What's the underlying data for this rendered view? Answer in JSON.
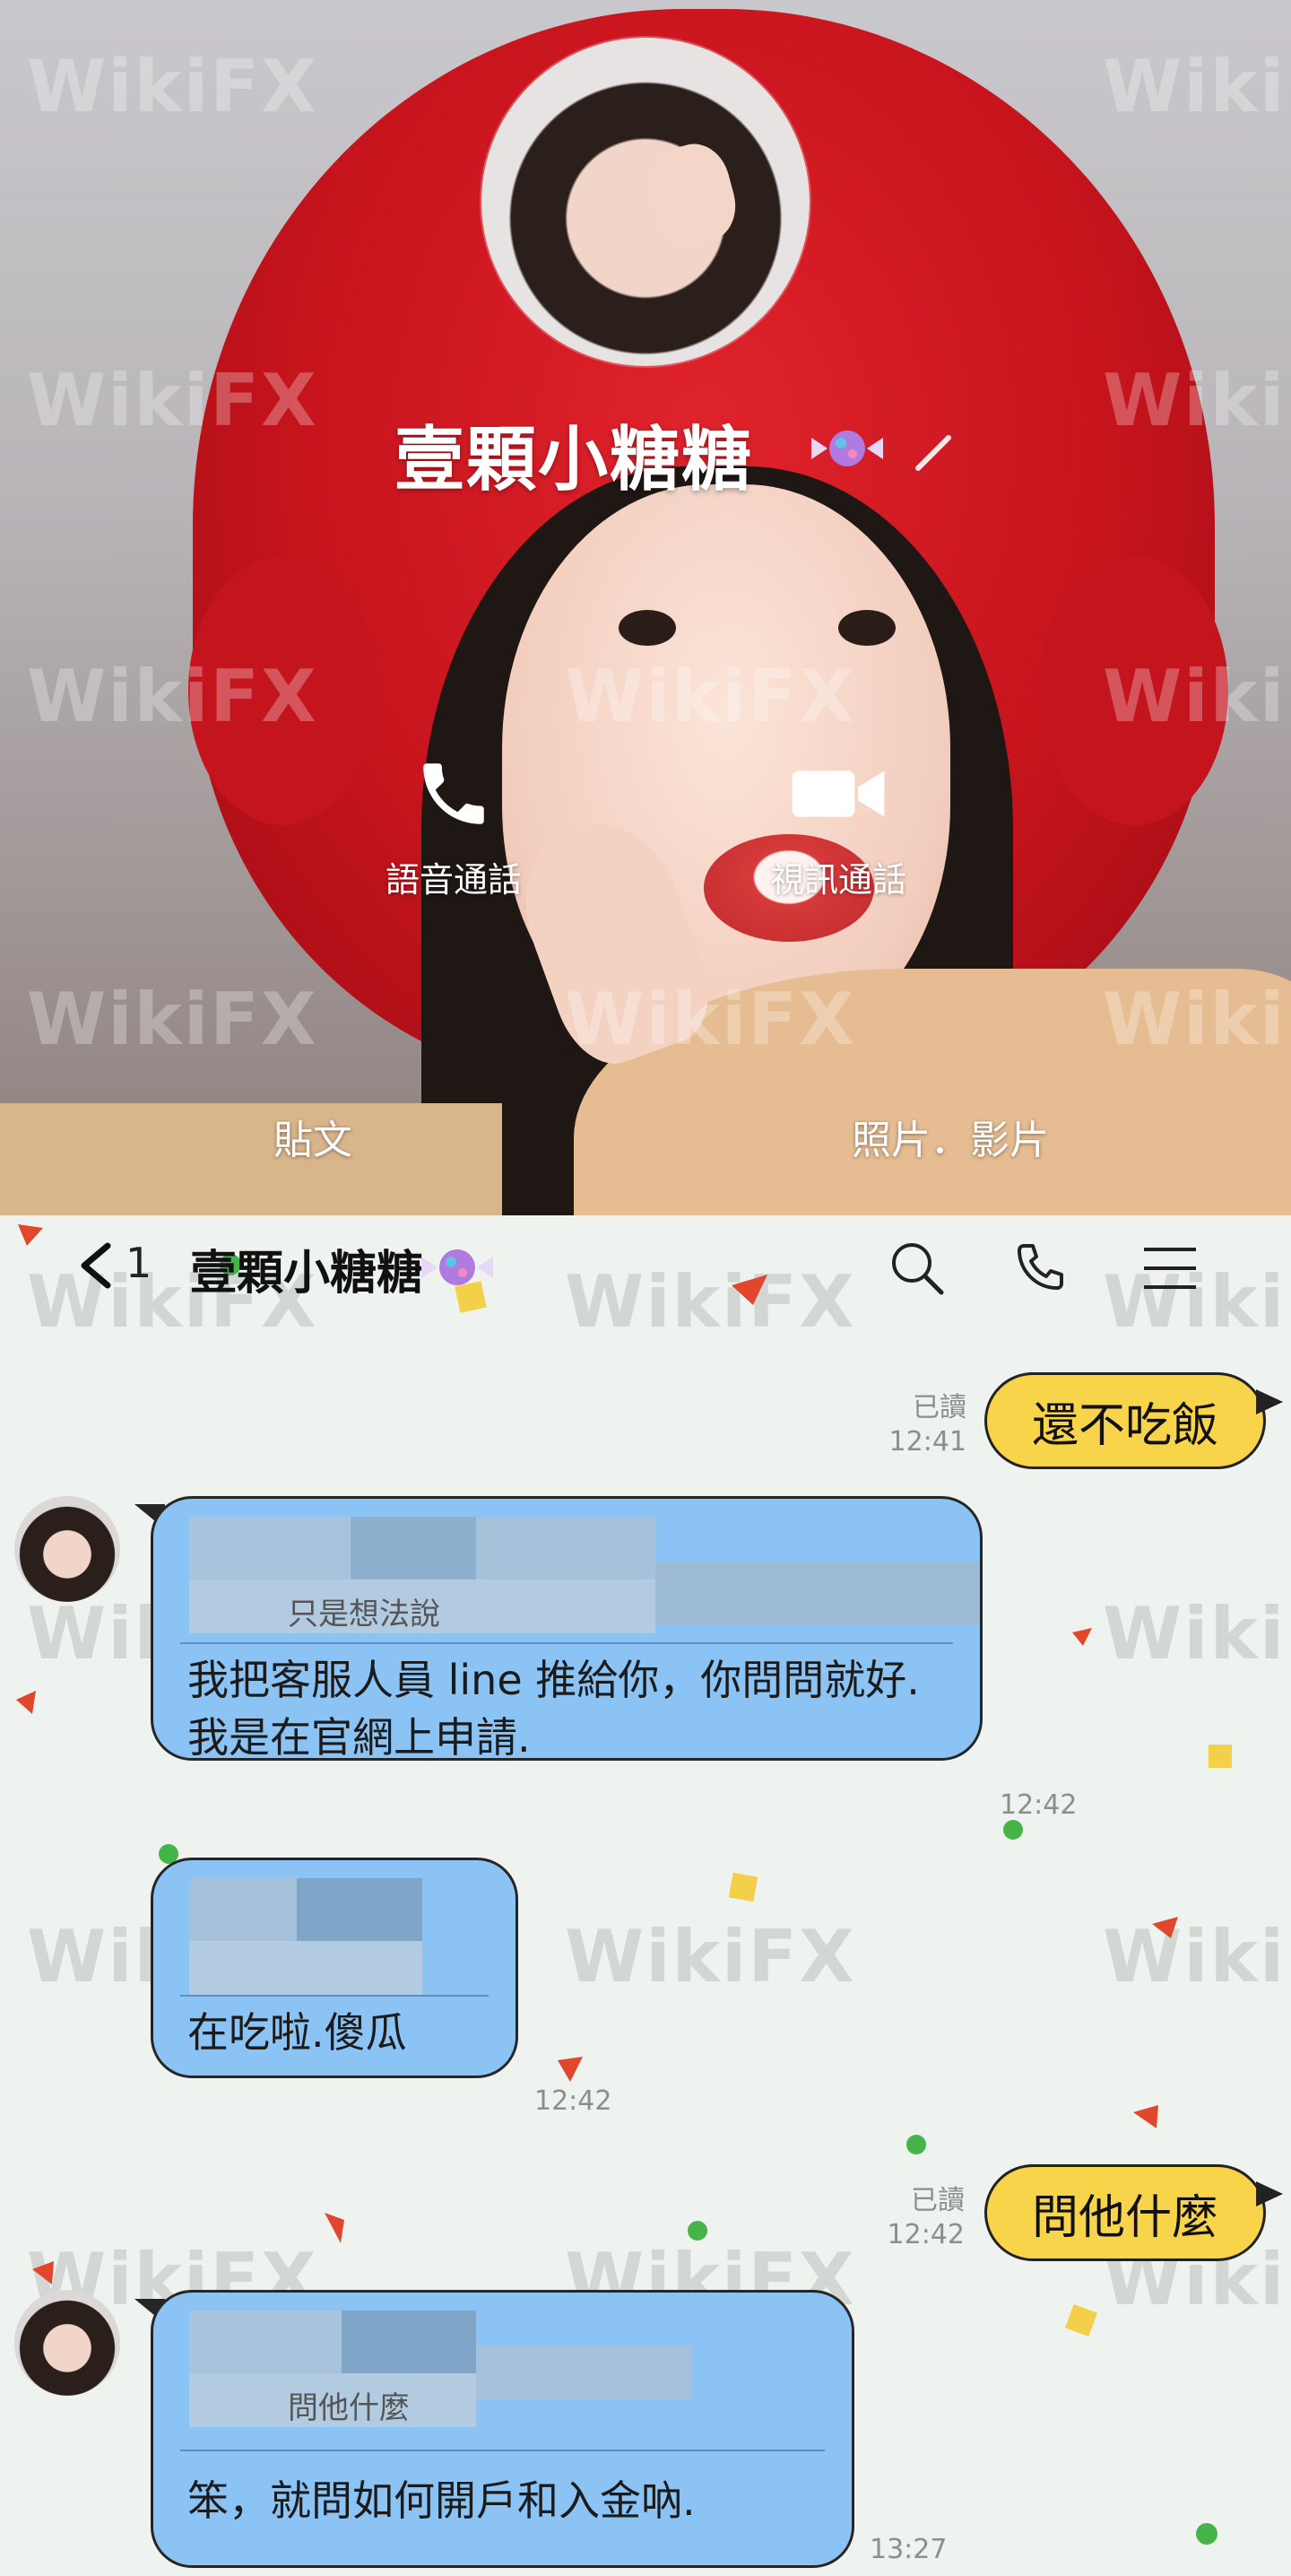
{
  "profile": {
    "name": "壹顆小糖糖",
    "voice_call_label": "語音通話",
    "video_call_label": "視訊通話",
    "posts_tab": "貼文",
    "photos_tab": "照片．影片"
  },
  "watermark": "WikiFX",
  "chat": {
    "back_count": "1",
    "title": "壹顆小糖糖",
    "messages": [
      {
        "from": "me",
        "read": "已讀",
        "time": "12:41",
        "text": "還不吃飯"
      },
      {
        "from": "them",
        "time": "12:42",
        "quote_fragment": "只是想法說",
        "text": "我把客服人員 line 推給你，你問問就好.我是在官網上申請."
      },
      {
        "from": "them",
        "time": "12:42",
        "text": "在吃啦.傻瓜"
      },
      {
        "from": "me",
        "read": "已讀",
        "time": "12:42",
        "text": "問他什麼"
      },
      {
        "from": "them",
        "time": "13:27",
        "quote_fragment": "問他什麼",
        "text": "笨，就問如何開戶和入金吶."
      }
    ]
  },
  "colors": {
    "my_bubble": "#f7d44a",
    "their_bubble": "#8bc3f4",
    "chat_bg": "#eef3ef",
    "hat_red": "#d21b24"
  },
  "icons": [
    "phone-icon",
    "video-camera-icon",
    "back-chevron-icon",
    "search-icon",
    "call-icon",
    "menu-icon",
    "candy-icon",
    "pencil-icon"
  ]
}
